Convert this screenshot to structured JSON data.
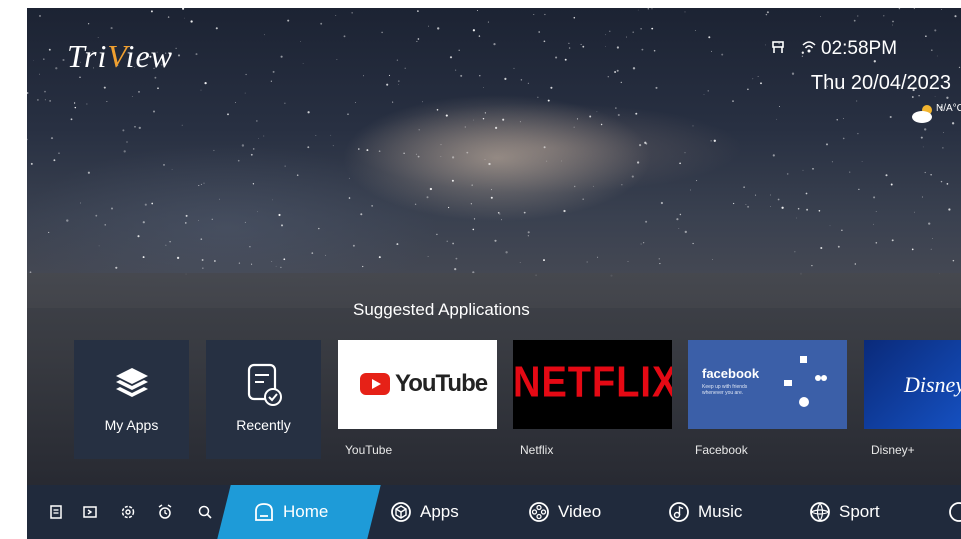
{
  "brand": {
    "logo_pre": "Tri",
    "logo_post": "iew"
  },
  "status": {
    "time": "02:58PM",
    "date": "Thu 20/04/2023",
    "temperature": "N/A°C"
  },
  "suggested": {
    "title": "Suggested Applications",
    "tiles": [
      {
        "label": "My Apps",
        "icon": "layers-icon"
      },
      {
        "label": "Recently",
        "icon": "history-check-icon"
      }
    ],
    "apps": [
      {
        "name": "YouTube",
        "logo": "YouTube"
      },
      {
        "name": "Netflix",
        "logo": "NETFLIX"
      },
      {
        "name": "Facebook",
        "logo": "facebook",
        "tagline": "Keep up with friends whenever you are."
      },
      {
        "name": "Disney+",
        "logo": "Disney"
      }
    ]
  },
  "nav": {
    "icons": [
      "notes-icon",
      "input-source-icon",
      "settings-icon",
      "alarm-icon",
      "search-icon"
    ],
    "tabs": [
      {
        "label": "Home",
        "active": true
      },
      {
        "label": "Apps"
      },
      {
        "label": "Video"
      },
      {
        "label": "Music"
      },
      {
        "label": "Sport"
      }
    ]
  },
  "colors": {
    "accent": "#1e9bd8",
    "nav_bg": "#202a3c",
    "tile_bg": "#263042",
    "youtube_red": "#e62117",
    "netflix_red": "#e50914",
    "facebook_blue": "#3b5fa8"
  }
}
